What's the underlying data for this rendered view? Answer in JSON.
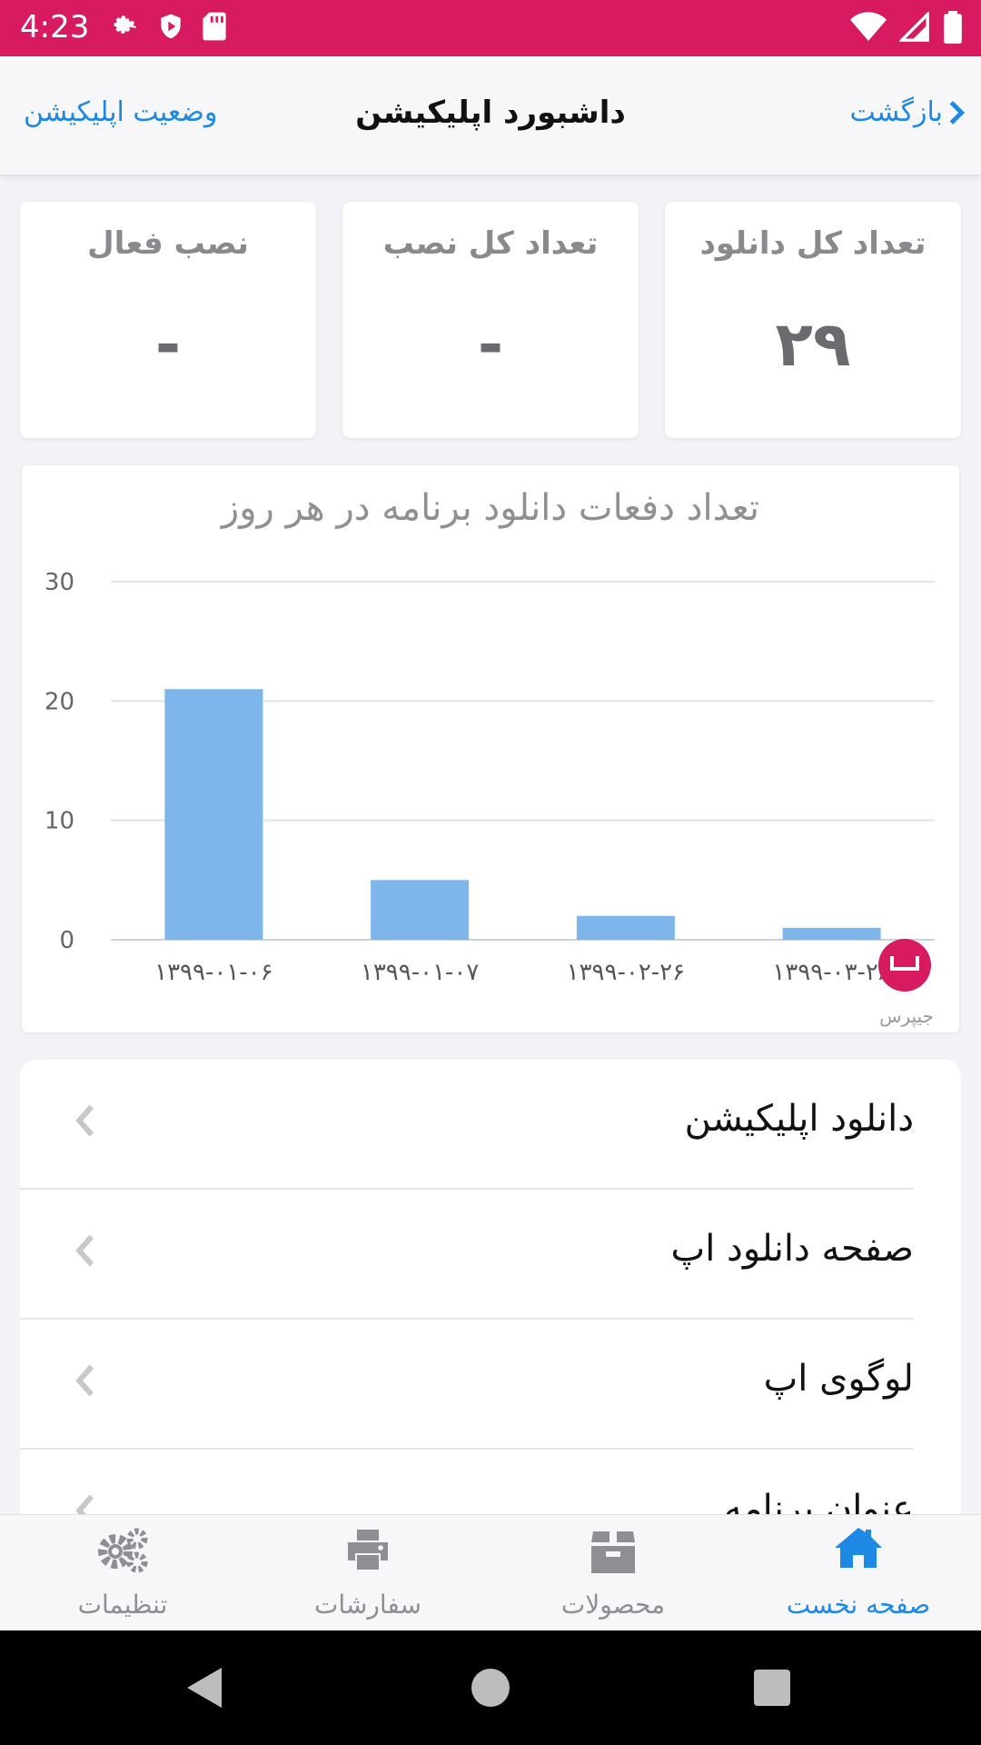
{
  "status_bar": {
    "time": "4:23",
    "background": "#d81b60"
  },
  "header": {
    "title": "داشبورد اپلیکیشن",
    "back_label": "بازگشت",
    "right_link": "وضعیت اپلیکیشن"
  },
  "stats": [
    {
      "label": "تعداد کل دانلود",
      "value": "۲۹"
    },
    {
      "label": "تعداد کل نصب",
      "value": "-"
    },
    {
      "label": "نصب فعال",
      "value": "-"
    }
  ],
  "chart_data": {
    "type": "bar",
    "title": "تعداد دفعات دانلود برنامه در هر روز",
    "categories": [
      "۱۳۹۹-۰۱-۰۶",
      "۱۳۹۹-۰۱-۰۷",
      "۱۳۹۹-۰۲-۲۶",
      "۱۳۹۹-۰۳-۲۸"
    ],
    "values": [
      21,
      5,
      2,
      1
    ],
    "yticks": [
      "0",
      "10",
      "20",
      "30"
    ],
    "ylim": [
      0,
      30
    ],
    "grid": true,
    "bar_color": "#7eb6ec"
  },
  "watermark": "جیپرس",
  "menu_items": [
    {
      "label": "دانلود اپلیکیشن"
    },
    {
      "label": "صفحه دانلود اپ"
    },
    {
      "label": "لوگوی اپ"
    },
    {
      "label": "عنوان برنامه"
    }
  ],
  "tabs": [
    {
      "label": "صفحه نخست",
      "icon": "home-icon",
      "active": true
    },
    {
      "label": "محصولات",
      "icon": "box-icon"
    },
    {
      "label": "سفارشات",
      "icon": "printer-icon"
    },
    {
      "label": "تنظیمات",
      "icon": "gears-icon"
    }
  ],
  "accent_color": "#1e88e5"
}
